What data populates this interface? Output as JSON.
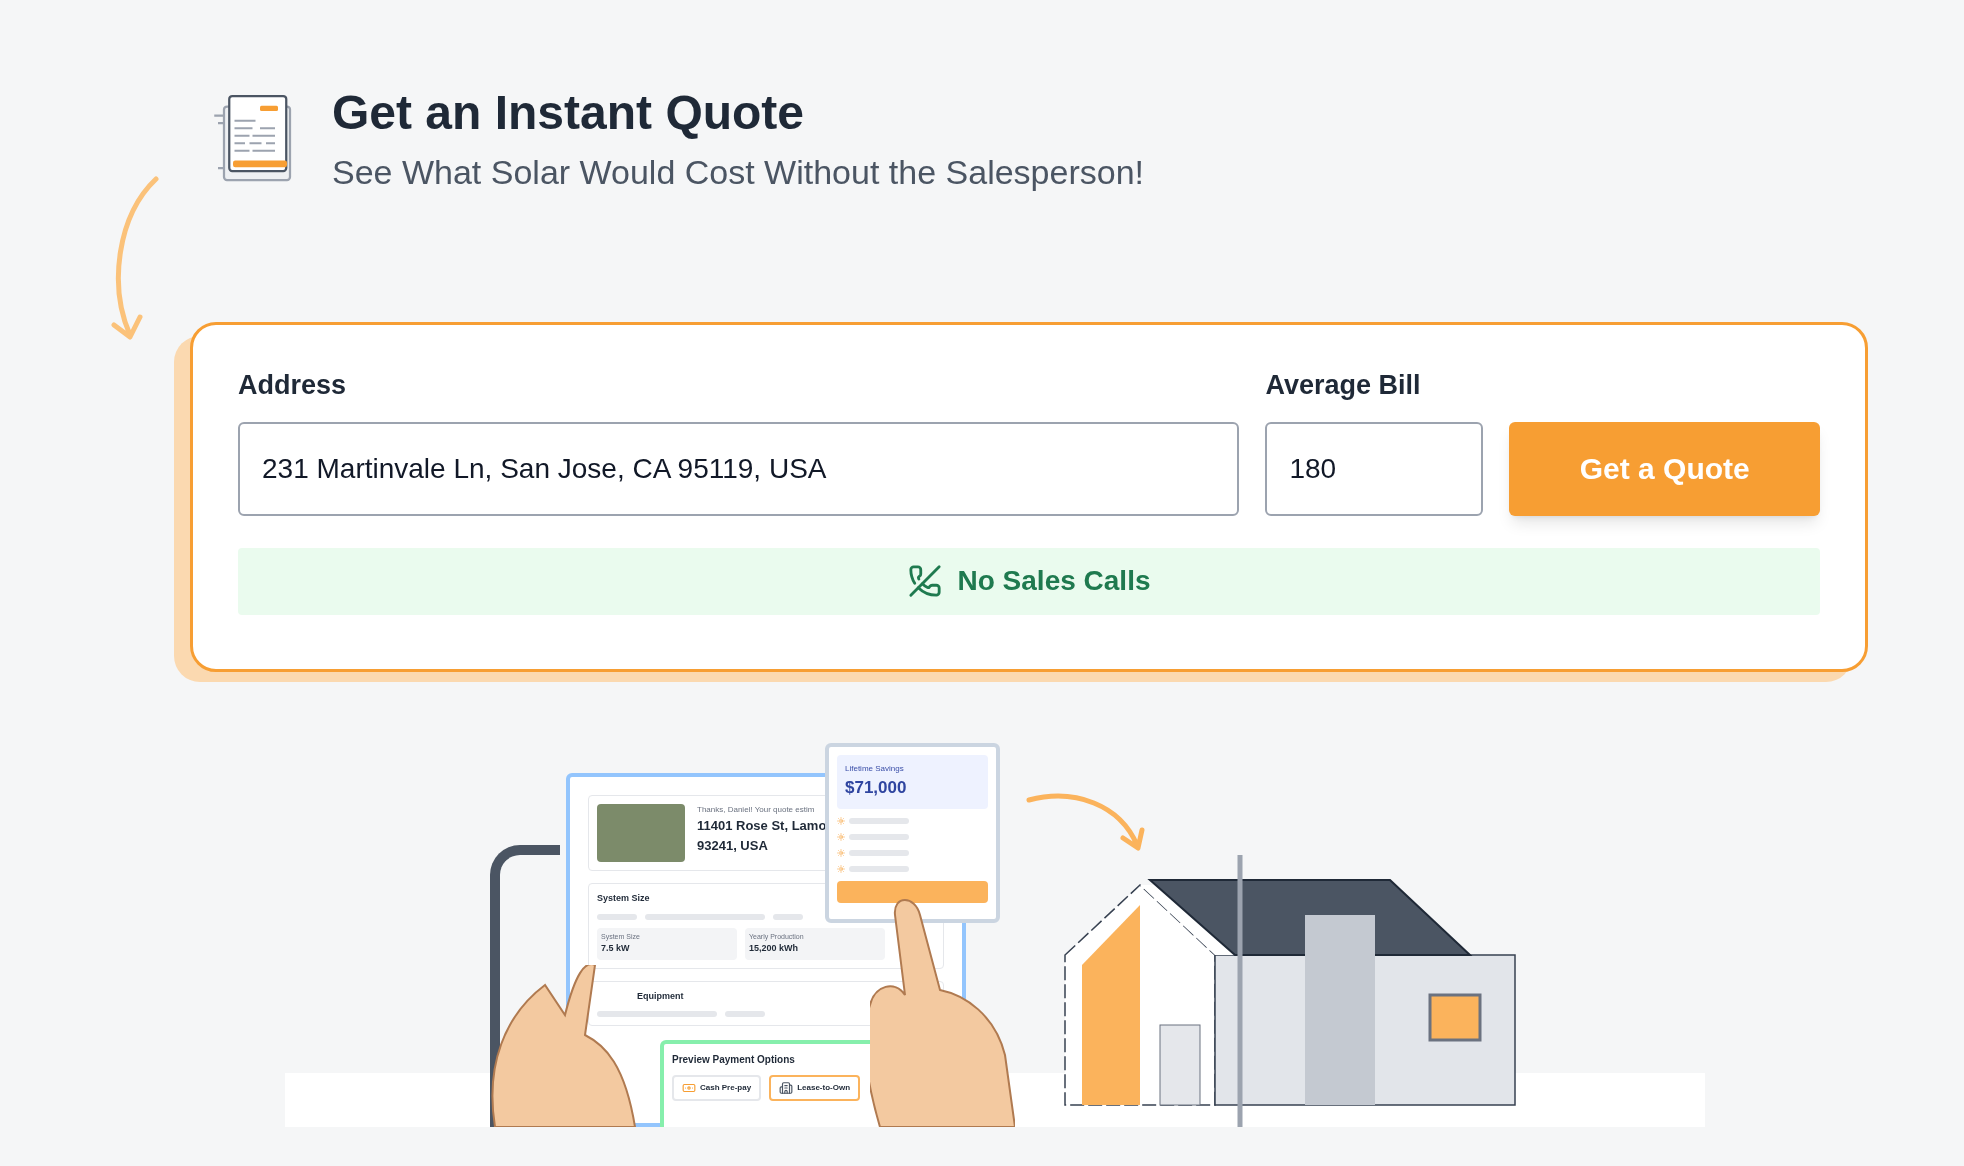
{
  "header": {
    "title": "Get an Instant Quote",
    "subtitle": "See What Solar Would Cost Without the Salesperson!"
  },
  "form": {
    "address": {
      "label": "Address",
      "value": "231 Martinvale Ln, San Jose, CA 95119, USA"
    },
    "bill": {
      "label": "Average Bill",
      "value": "180"
    },
    "submit": "Get a Quote",
    "notice": "No Sales Calls"
  },
  "illustration": {
    "greeting": "Thanks, Daniel! Your quote estim",
    "address_line_1": "11401 Rose St, Lamo",
    "address_line_2": "93241, USA",
    "section_title": "System Size",
    "stats": [
      {
        "label": "System Size",
        "value": "7.5 kW"
      },
      {
        "label": "Yearly Production",
        "value": "15,200 kWh"
      }
    ],
    "equipment_title": "Equipment",
    "savings": {
      "label": "Lifetime Savings",
      "value": "$71,000"
    },
    "payment": {
      "title": "Preview Payment Options",
      "options": [
        {
          "label": "Cash Pre-pay",
          "selected": false
        },
        {
          "label": "Lease-to-Own",
          "selected": true
        }
      ]
    }
  }
}
